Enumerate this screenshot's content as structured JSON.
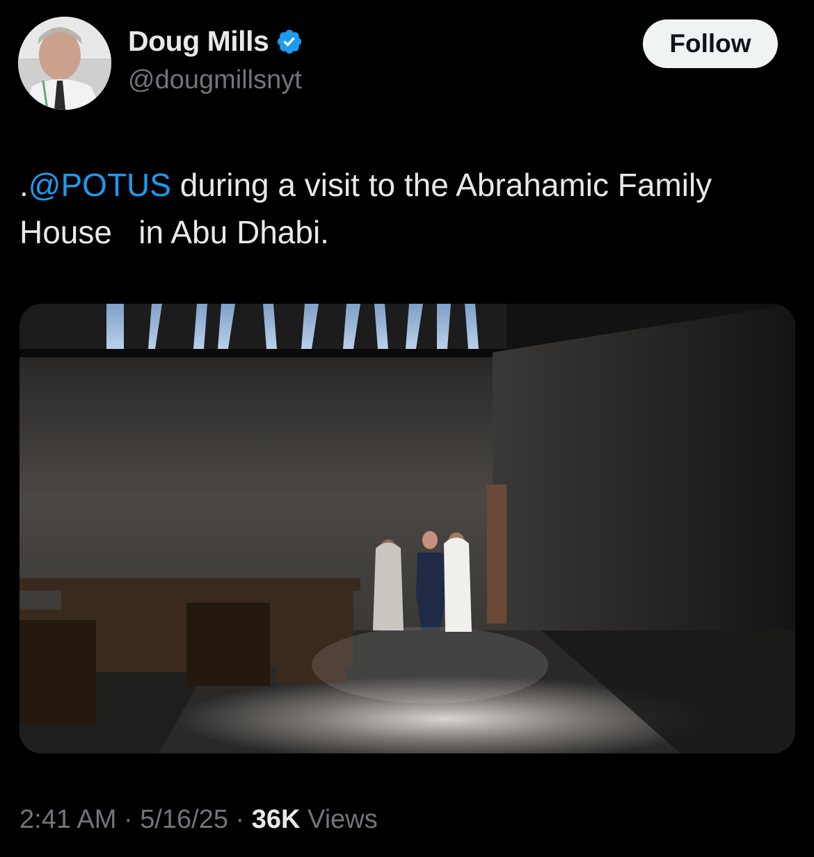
{
  "author": {
    "name": "Doug Mills",
    "handle": "@dougmillsnyt",
    "verified": true,
    "avatar_icon": "profile-photo"
  },
  "follow_button": {
    "label": "Follow"
  },
  "tweet": {
    "prefix": ".",
    "mention": "@POTUS",
    "body_line1": " during a visit to the Abrahamic Family",
    "body_line2": "House   in Abu Dhabi."
  },
  "media": {
    "description_icon": "photo"
  },
  "meta": {
    "time": "2:41 AM",
    "sep1": " · ",
    "date": "5/16/25",
    "sep2": " · ",
    "views_count": "36K",
    "views_label": " Views"
  },
  "colors": {
    "background": "#000000",
    "text": "#e7e9ea",
    "secondary": "#71767b",
    "link": "#1d9bf0",
    "follow_bg": "#eff3f4"
  }
}
